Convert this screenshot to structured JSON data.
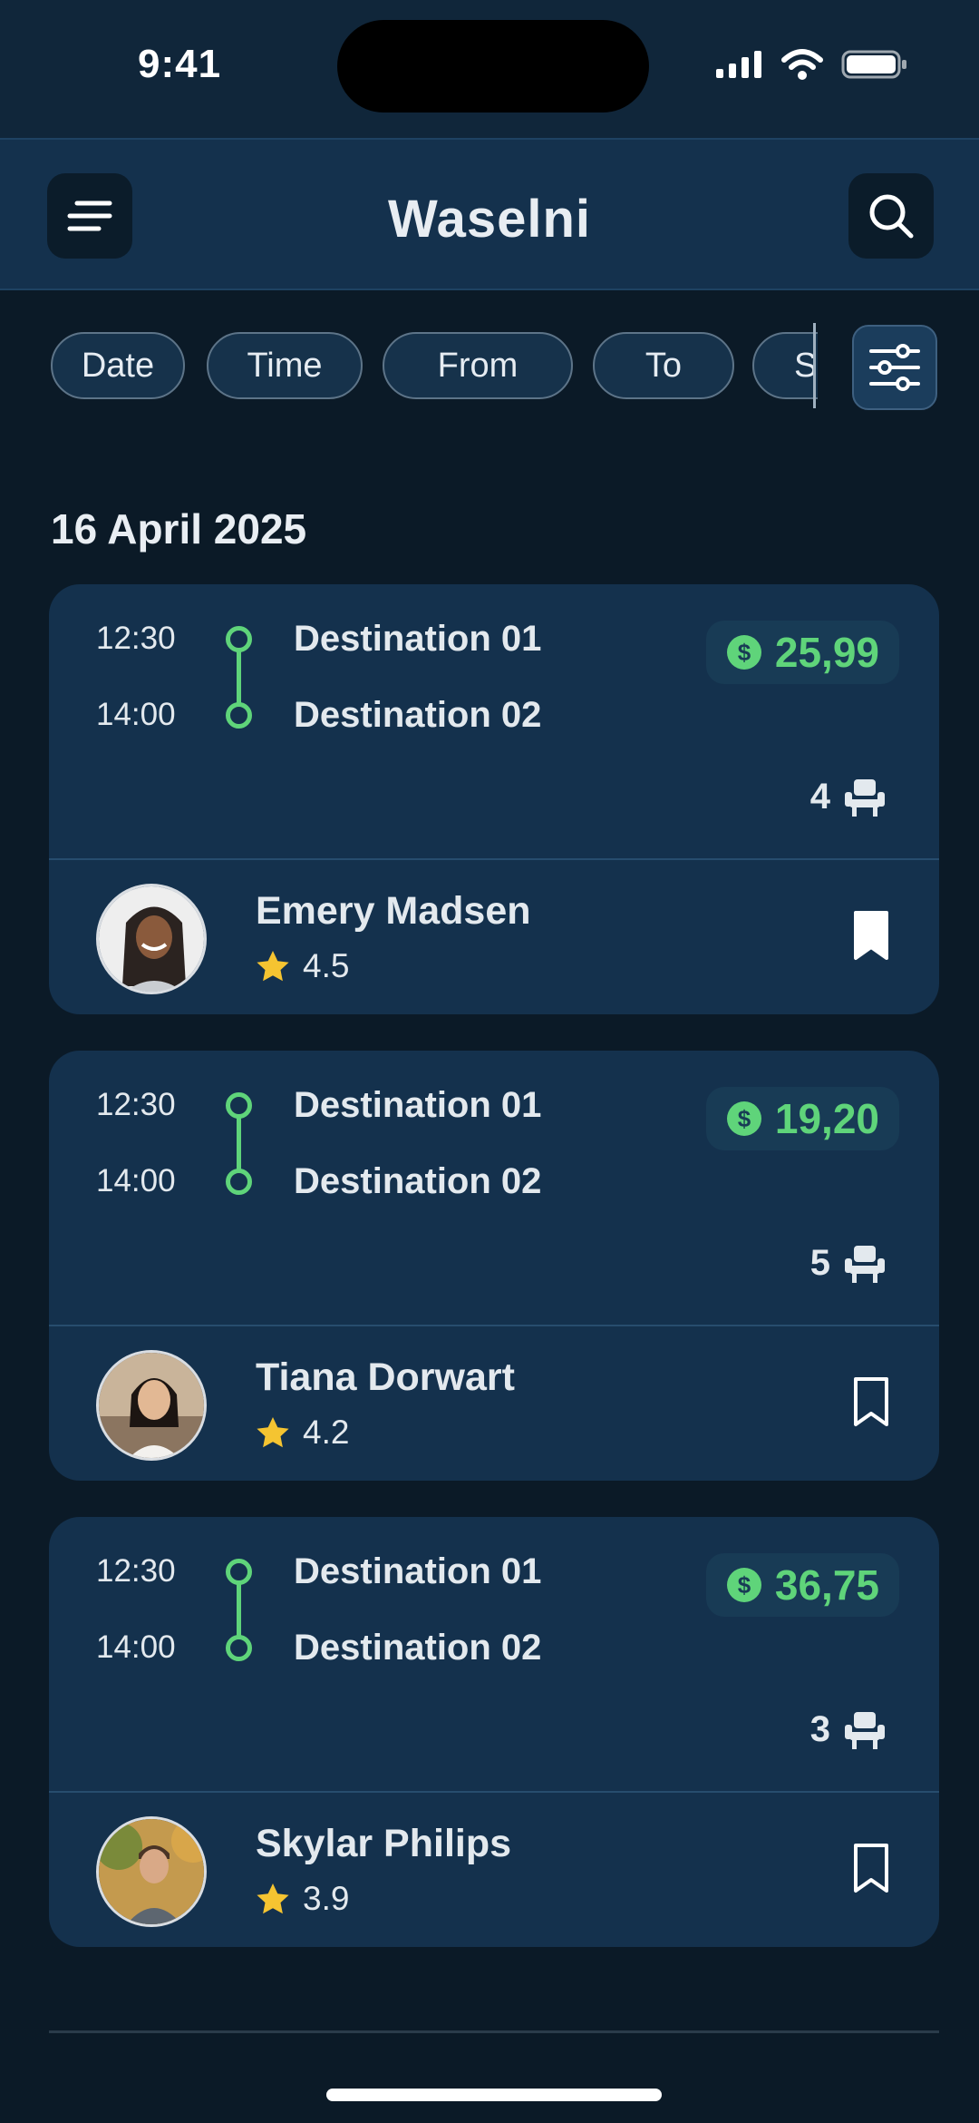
{
  "status_bar": {
    "time": "9:41"
  },
  "header": {
    "title": "Waselni"
  },
  "filters": [
    {
      "label": "Date"
    },
    {
      "label": "Time"
    },
    {
      "label": "From"
    },
    {
      "label": "To"
    },
    {
      "label": "S"
    }
  ],
  "date_heading": "16 April 2025",
  "colors": {
    "accent_green": "#5fd47a",
    "card": "#14314d",
    "background": "#0b1a27",
    "star": "#f5c431"
  },
  "rides": [
    {
      "departure_time": "12:30",
      "arrival_time": "14:00",
      "from": "Destination 01",
      "to": "Destination 02",
      "price": "25,99",
      "seats": "4",
      "driver": "Emery Madsen",
      "rating": "4.5",
      "bookmarked": true
    },
    {
      "departure_time": "12:30",
      "arrival_time": "14:00",
      "from": "Destination 01",
      "to": "Destination 02",
      "price": "19,20",
      "seats": "5",
      "driver": "Tiana Dorwart",
      "rating": "4.2",
      "bookmarked": false
    },
    {
      "departure_time": "12:30",
      "arrival_time": "14:00",
      "from": "Destination 01",
      "to": "Destination 02",
      "price": "36,75",
      "seats": "3",
      "driver": "Skylar Philips",
      "rating": "3.9",
      "bookmarked": false
    }
  ],
  "icons": {
    "menu": "menu-icon",
    "search": "search-icon",
    "filter": "sliders-icon",
    "price": "dollar-icon",
    "seat": "seat-icon",
    "rating": "star-icon",
    "bookmark": "bookmark-icon"
  }
}
